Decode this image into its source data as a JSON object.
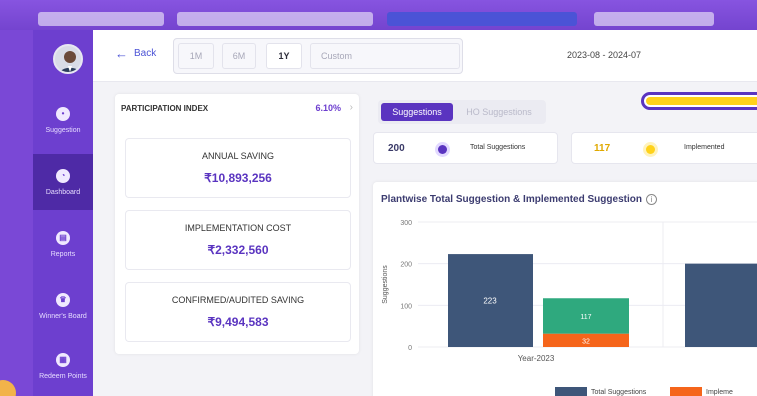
{
  "sidebar": {
    "items": [
      {
        "label": "Suggestion",
        "icon": "bulb-icon"
      },
      {
        "label": "Dashboard",
        "icon": "dashboard-icon"
      },
      {
        "label": "Reports",
        "icon": "report-icon"
      },
      {
        "label": "Winner's Board",
        "icon": "trophy-icon"
      },
      {
        "label": "Redeem Points",
        "icon": "gift-icon"
      }
    ],
    "active": "Dashboard"
  },
  "header": {
    "back_label": "Back",
    "ranges": [
      "1M",
      "6M",
      "1Y",
      "Custom"
    ],
    "selected_range": "1Y",
    "date_range": "2023-08 - 2024-07"
  },
  "participation": {
    "title": "PARTICIPATION INDEX",
    "value": "6.10%"
  },
  "metrics": [
    {
      "label": "ANNUAL SAVING",
      "value": "₹10,893,256"
    },
    {
      "label": "IMPLEMENTATION COST",
      "value": "₹2,332,560"
    },
    {
      "label": "CONFIRMED/AUDITED SAVING",
      "value": "₹9,494,583"
    }
  ],
  "segments": {
    "active": "Suggestions",
    "inactive": "HO Suggestions"
  },
  "stats": [
    {
      "value": "200",
      "label": "Total Suggestions",
      "color": "#5a34c0"
    },
    {
      "value": "117",
      "label": "Implemented",
      "color": "#ffd21a"
    }
  ],
  "progress_fraction": 0.98,
  "chart": {
    "title": "Plantwise Total Suggestion & Implemented Suggestion",
    "info_icon": "info-icon",
    "legend": [
      "Total Suggestions",
      "Impleme"
    ]
  },
  "chart_data": {
    "type": "bar",
    "categories": [
      "Year-2023"
    ],
    "ylabel": "Suggestions",
    "ylim": [
      0,
      300
    ],
    "yticks": [
      0,
      100,
      200,
      300
    ],
    "series": [
      {
        "name": "Total Suggestions",
        "values": [
          223
        ],
        "color": "#3e5679"
      },
      {
        "name": "Implemented",
        "stack": [
          {
            "values": [
              117
            ],
            "color": "#2fa97e"
          },
          {
            "values": [
              32
            ],
            "color": "#f5651b"
          }
        ]
      }
    ],
    "partial_next_bar": {
      "label": "200",
      "value": 200,
      "color": "#3e5679"
    },
    "grid": true
  }
}
